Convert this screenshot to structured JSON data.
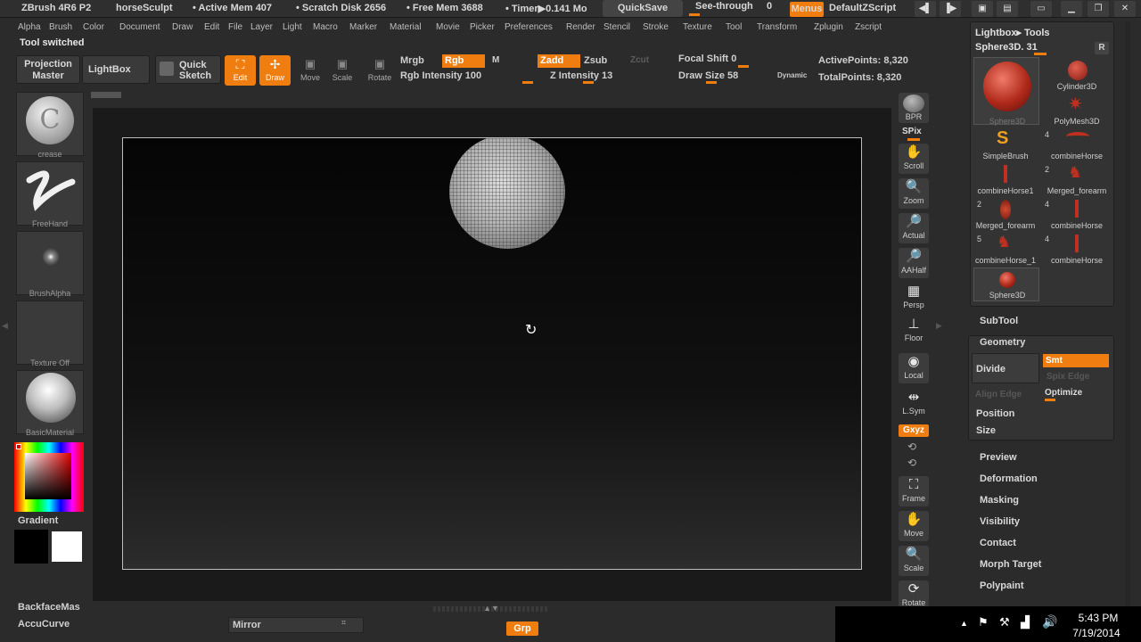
{
  "titlebar": {
    "app": "ZBrush 4R6 P2",
    "doc": "horseSculpt",
    "active_mem": "• Active Mem 407",
    "scratch": "• Scratch Disk 2656",
    "free_mem": "• Free Mem 3688",
    "timer": "• Timer▶0.141 Mo",
    "quicksave": "QuickSave",
    "see_through": "See-through",
    "see_through_value": "0",
    "menus": "Menus",
    "default_zscript": "DefaultZScript"
  },
  "menubar": [
    "Alpha",
    "Brush",
    "Color",
    "Document",
    "Draw",
    "Edit",
    "File",
    "Layer",
    "Light",
    "Macro",
    "Marker",
    "Material",
    "Movie",
    "Picker",
    "Preferences",
    "Render",
    "Stencil",
    "Stroke",
    "Texture",
    "Tool",
    "Transform",
    "Zplugin",
    "Zscript"
  ],
  "status_note": "Tool switched",
  "shelf": {
    "projection_master": "Projection Master",
    "lightbox": "LightBox",
    "quick_sketch": "Quick Sketch",
    "edit": "Edit",
    "draw": "Draw",
    "move": "Move",
    "scale": "Scale",
    "rotate": "Rotate",
    "mrgb": "Mrgb",
    "rgb": "Rgb",
    "m": "M",
    "zadd": "Zadd",
    "zsub": "Zsub",
    "zcut": "Zcut",
    "rgb_intensity": "Rgb Intensity 100",
    "z_intensity": "Z Intensity 13",
    "focal_shift": "Focal Shift 0",
    "draw_size": "Draw Size 58",
    "dynamic": "Dynamic",
    "active_points": "ActivePoints: 8,320",
    "total_points": "TotalPoints: 8,320"
  },
  "left_tray": {
    "brush_label": "crease",
    "stroke_label": "FreeHand",
    "alpha_label": "BrushAlpha",
    "texture_label": "Texture Off",
    "material_label": "BasicMaterial",
    "gradient": "Gradient",
    "backface": "BackfaceMas",
    "accucurve": "AccuCurve"
  },
  "right_shelf": {
    "bpr": "BPR",
    "spix": "SPix",
    "scroll": "Scroll",
    "zoom": "Zoom",
    "actual": "Actual",
    "aahalf": "AAHalf",
    "persp": "Persp",
    "floor": "Floor",
    "local": "Local",
    "lsym": "L.Sym",
    "xyz": "Gxyz",
    "frame": "Frame",
    "move": "Move",
    "scale": "Scale",
    "rotate": "Rotate"
  },
  "tool_palette": {
    "header": "Lightbox▸ Tools",
    "current": "Sphere3D. 31",
    "r_button": "R",
    "tools": [
      {
        "name": "Sphere3D",
        "count": ""
      },
      {
        "name": "Cylinder3D",
        "count": ""
      },
      {
        "name": "PolyMesh3D",
        "count": ""
      },
      {
        "name": "SimpleBrush",
        "count": ""
      },
      {
        "name": "combineHorse",
        "count": "4"
      },
      {
        "name": "combineHorse1",
        "count": ""
      },
      {
        "name": "Merged_forearm",
        "count": "2"
      },
      {
        "name": "Merged_forearm",
        "count": "2"
      },
      {
        "name": "combineHorse",
        "count": "4"
      },
      {
        "name": "combineHorse_1",
        "count": "5"
      },
      {
        "name": "combineHorse",
        "count": "4"
      },
      {
        "name": "Sphere3D",
        "count": ""
      }
    ],
    "subtool": "SubTool",
    "geometry": "Geometry",
    "divide": "Divide",
    "smt": "Smt",
    "spix_edge": "Spix Edge",
    "align_edge": "Align Edge",
    "optimize": "Optimize",
    "position": "Position",
    "size": "Size",
    "sections": [
      "Preview",
      "Deformation",
      "Masking",
      "Visibility",
      "Contact",
      "Morph Target",
      "Polypaint"
    ]
  },
  "bottom": {
    "mirror": "Mirror",
    "grp": "Grp"
  },
  "taskbar": {
    "time": "5:43 PM",
    "date": "7/19/2014"
  },
  "colors": {
    "accent": "#ef7d10",
    "canvas": "#0d0d0d",
    "ui_bg": "#2b2b2b"
  }
}
